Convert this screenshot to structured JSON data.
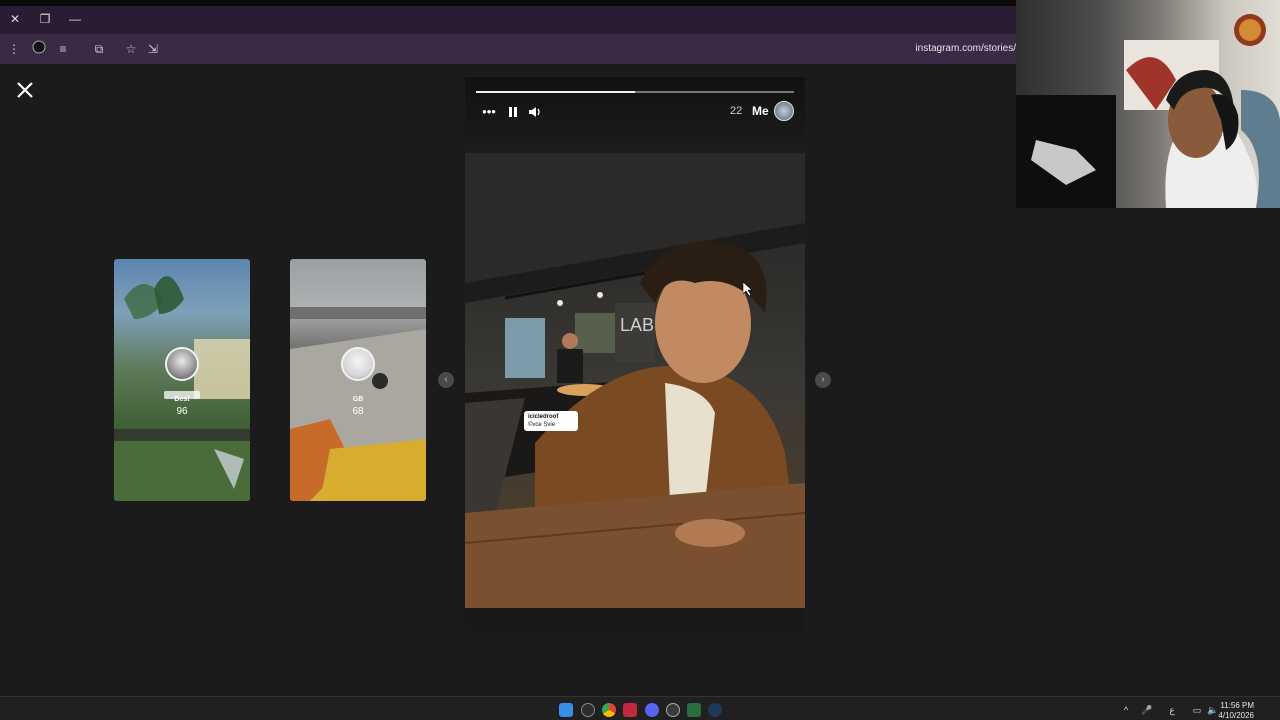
{
  "browser": {
    "url": "instagram.com/stories/"
  },
  "viewer": {
    "thumbnails": [
      {
        "name": "Dest",
        "time": "96"
      },
      {
        "name": "GB",
        "time": "68"
      }
    ],
    "story": {
      "progress_percent": 50,
      "user": "Me",
      "time": "22",
      "mention_name": "icicledroof",
      "mention_sub": "©vce Svie",
      "sign_text": "LAB"
    }
  },
  "taskbar": {
    "time": "11:56 PM",
    "date": "4/10/2026",
    "language": "ع"
  },
  "colors": {
    "titlebar": "#2a1d33",
    "toolbar": "#3a2a45",
    "viewer_bg": "#1b1b1b"
  }
}
